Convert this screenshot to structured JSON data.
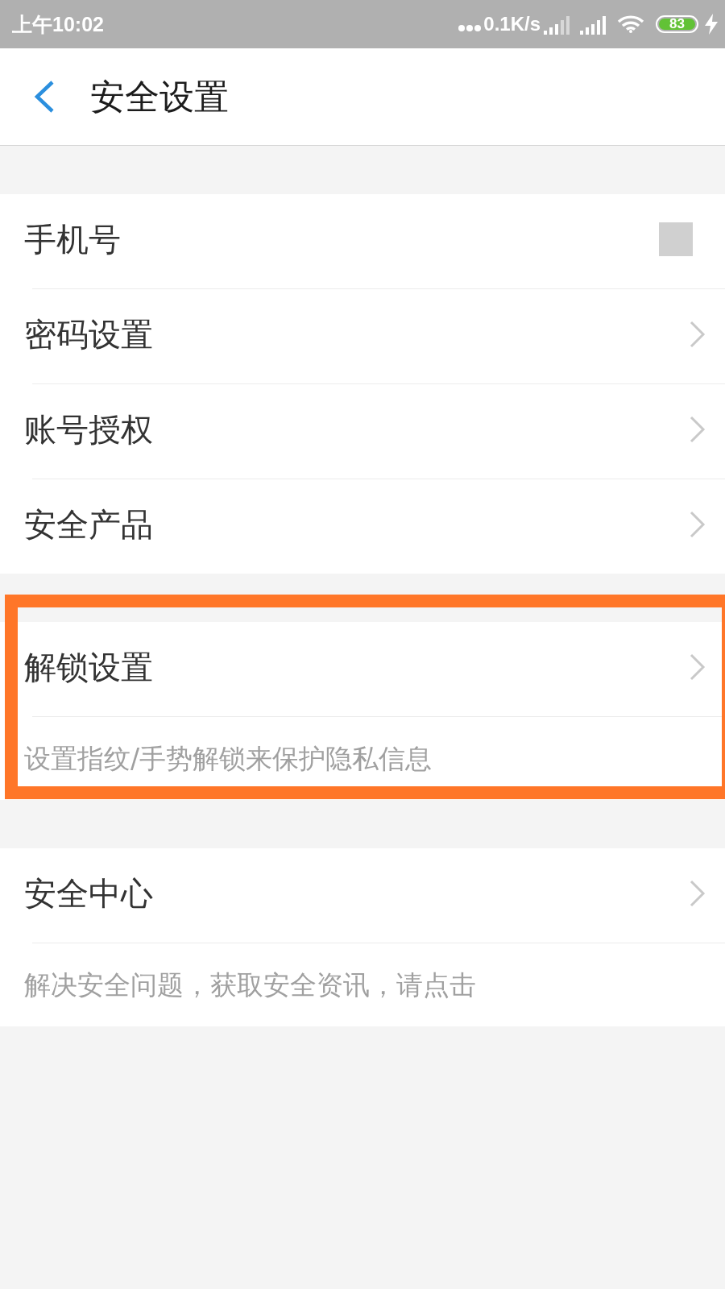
{
  "status_bar": {
    "time": "上午10:02",
    "network_speed": "0.1K/s",
    "battery": "83"
  },
  "header": {
    "title": "安全设置"
  },
  "sections": [
    {
      "highlighted": false,
      "items": [
        {
          "kind": "masked",
          "label": "手机号"
        },
        {
          "kind": "link",
          "label": "密码设置"
        },
        {
          "kind": "link",
          "label": "账号授权"
        },
        {
          "kind": "link",
          "label": "安全产品"
        }
      ]
    },
    {
      "highlighted": true,
      "items": [
        {
          "kind": "link",
          "label": "解锁设置"
        },
        {
          "kind": "note",
          "text": "设置指纹/手势解锁来保护隐私信息"
        }
      ]
    },
    {
      "highlighted": false,
      "items": [
        {
          "kind": "link",
          "label": "安全中心"
        },
        {
          "kind": "note",
          "text": "解决安全问题，获取安全资讯，请点击"
        }
      ]
    }
  ]
}
